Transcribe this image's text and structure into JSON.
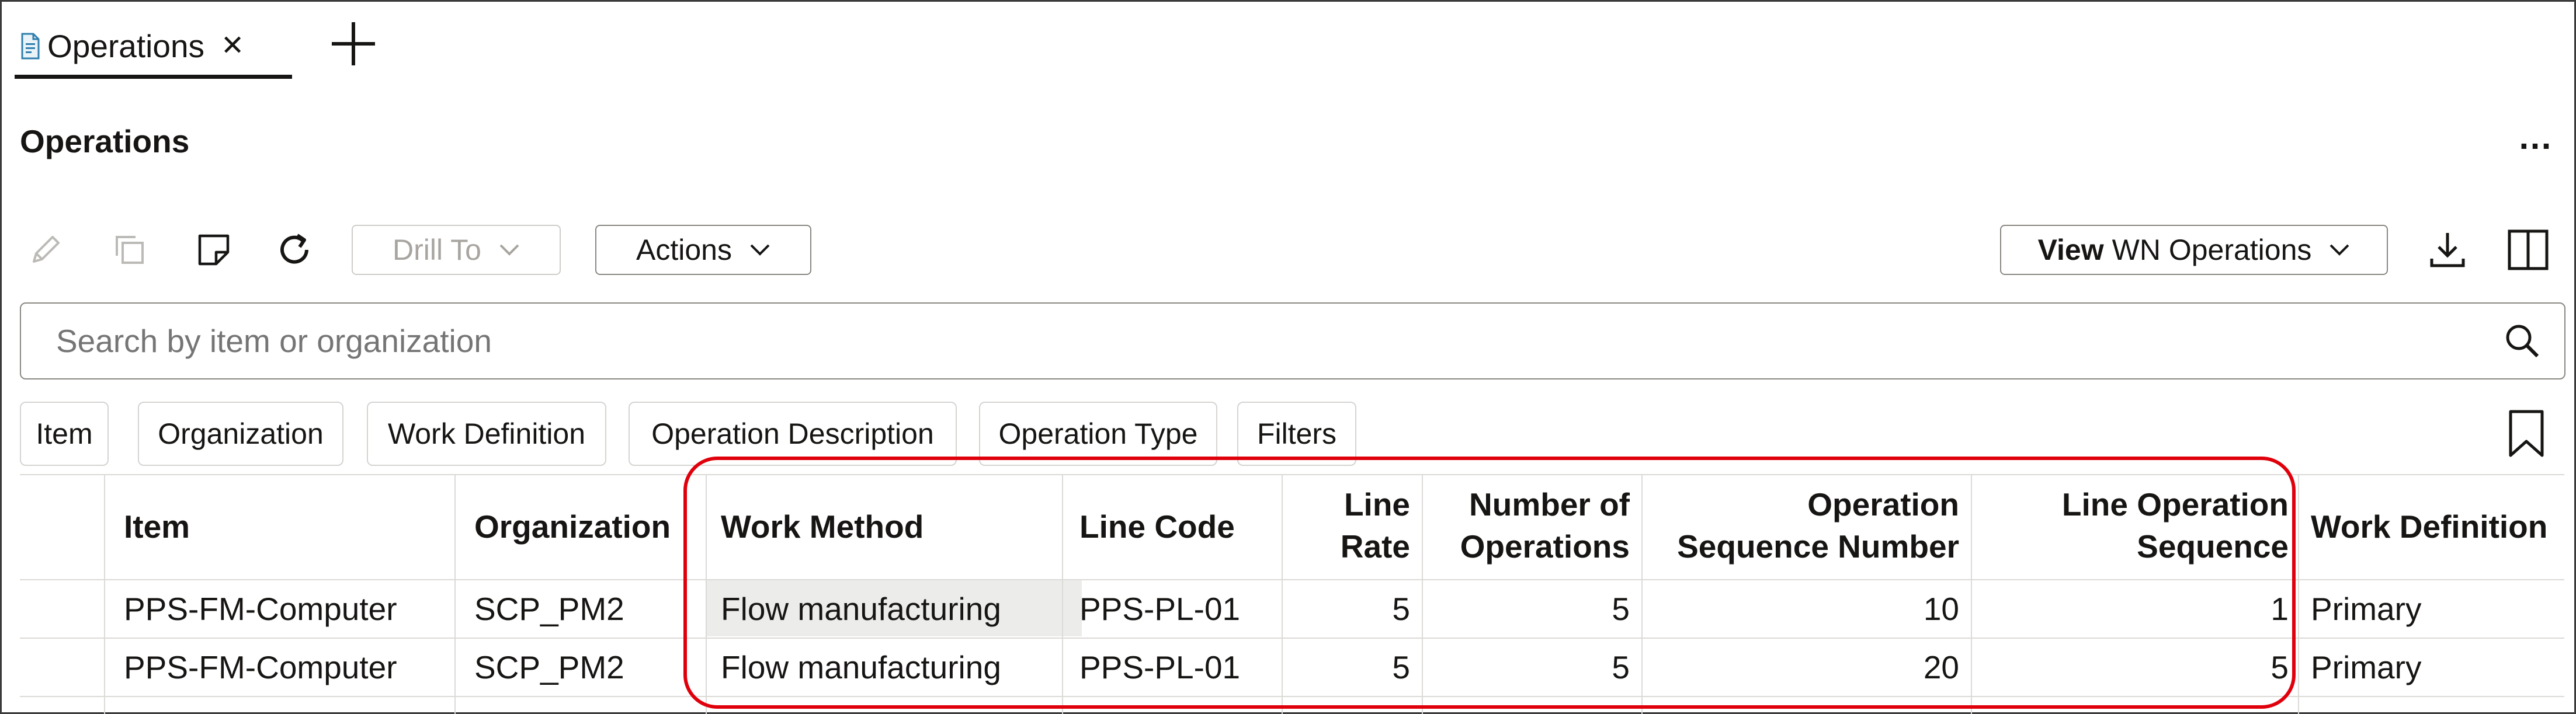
{
  "tab": {
    "title": "Operations",
    "close_icon": "close-icon",
    "new_tab_icon": "plus-icon"
  },
  "page": {
    "title": "Operations",
    "more_label": "…"
  },
  "toolbar": {
    "drill_to_label": "Drill To",
    "actions_label": "Actions",
    "view_label_bold": "View",
    "view_label_rest": "WN Operations",
    "icons": [
      "edit-icon",
      "duplicate-icon",
      "note-icon",
      "refresh-icon",
      "download-icon",
      "columns-icon"
    ]
  },
  "search": {
    "placeholder": "Search by item or organization"
  },
  "filters": [
    "Item",
    "Organization",
    "Work Definition",
    "Operation Description",
    "Operation Type",
    "Filters"
  ],
  "table": {
    "headers": {
      "item": "Item",
      "organization": "Organization",
      "work_method": "Work Method",
      "line_code": "Line Code",
      "line_rate_1": "Line",
      "line_rate_2": "Rate",
      "num_ops_1": "Number of",
      "num_ops_2": "Operations",
      "op_seq_1": "Operation",
      "op_seq_2": "Sequence Number",
      "line_op_seq_1": "Line Operation",
      "line_op_seq_2": "Sequence",
      "work_definition": "Work Definition"
    },
    "rows": [
      {
        "item": "PPS-FM-Computer",
        "organization": "SCP_PM2",
        "work_method": "Flow manufacturing",
        "line_code": "PPS-PL-01",
        "line_rate": "5",
        "num_ops": "5",
        "op_seq": "10",
        "line_op_seq": "1",
        "work_definition": "Primary"
      },
      {
        "item": "PPS-FM-Computer",
        "organization": "SCP_PM2",
        "work_method": "Flow manufacturing",
        "line_code": "PPS-PL-01",
        "line_rate": "5",
        "num_ops": "5",
        "op_seq": "20",
        "line_op_seq": "5",
        "work_definition": "Primary"
      }
    ]
  },
  "colors": {
    "annotation": "#e0000b",
    "text": "#161513",
    "border": "#8a8782"
  }
}
